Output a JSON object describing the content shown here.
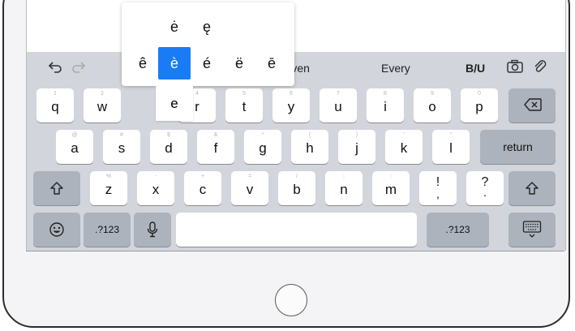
{
  "accent_popup": {
    "row_top": [
      "ė",
      "ę"
    ],
    "row_bottom": [
      "ê",
      "è",
      "é",
      "ë",
      "ē"
    ],
    "selected": "è"
  },
  "shortcuts": {
    "bold_italic_underline": "B/U"
  },
  "suggestions": [
    "Even",
    "Every"
  ],
  "keyboard": {
    "row1": [
      {
        "char": "q",
        "hint": "1"
      },
      {
        "char": "w",
        "hint": "2"
      },
      {
        "char": "e",
        "hint": "3"
      },
      {
        "char": "r",
        "hint": "4"
      },
      {
        "char": "t",
        "hint": "5"
      },
      {
        "char": "y",
        "hint": "6"
      },
      {
        "char": "u",
        "hint": "7"
      },
      {
        "char": "i",
        "hint": "8"
      },
      {
        "char": "o",
        "hint": "9"
      },
      {
        "char": "p",
        "hint": "0"
      }
    ],
    "row2": [
      {
        "char": "a",
        "hint": "@"
      },
      {
        "char": "s",
        "hint": "#"
      },
      {
        "char": "d",
        "hint": "$"
      },
      {
        "char": "f",
        "hint": "&"
      },
      {
        "char": "g",
        "hint": "*"
      },
      {
        "char": "h",
        "hint": "("
      },
      {
        "char": "j",
        "hint": ")"
      },
      {
        "char": "k",
        "hint": "'"
      },
      {
        "char": "l",
        "hint": "\""
      }
    ],
    "row3": [
      {
        "char": "z",
        "hint": "%"
      },
      {
        "char": "x",
        "hint": "-"
      },
      {
        "char": "c",
        "hint": "+"
      },
      {
        "char": "v",
        "hint": "="
      },
      {
        "char": "b",
        "hint": "/"
      },
      {
        "char": "n",
        "hint": ";"
      },
      {
        "char": "m",
        "hint": ":"
      },
      {
        "char": "!",
        "hint": ""
      },
      {
        "char": "?",
        "hint": ""
      }
    ],
    "row3_sub": {
      "!": ",",
      "?": "."
    },
    "return_label": "return",
    "numbers_label": ".?123"
  },
  "colors": {
    "keyboard_bg": "#d2d5db",
    "key_bg": "#ffffff",
    "dark_key_bg": "#adb3bc",
    "accent_selected": "#1a7cf5"
  }
}
